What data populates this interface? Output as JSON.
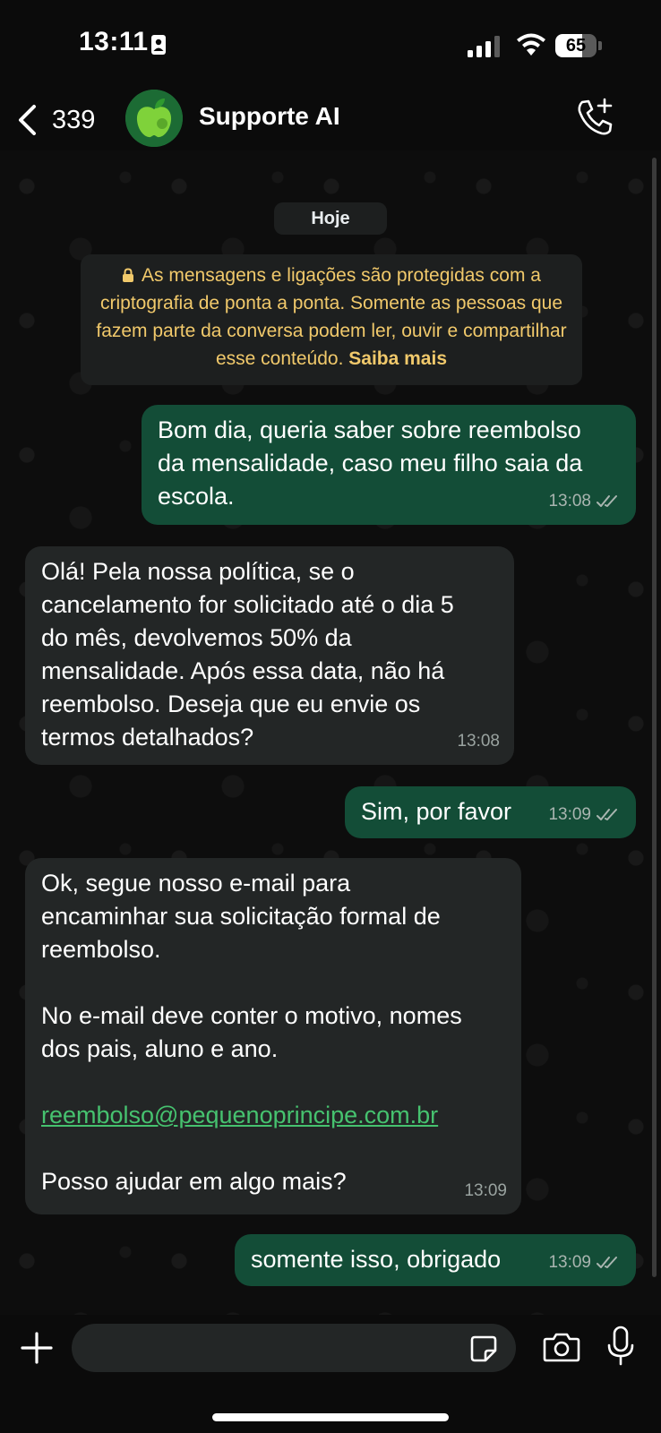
{
  "status": {
    "time": "13:11",
    "battery": "65",
    "battery_level": 0.65
  },
  "header": {
    "back_count": "339",
    "contact_name": "Supporte AI"
  },
  "chat": {
    "date": "Hoje",
    "encryption_text": "As mensagens e ligações são protegidas com a criptografia de ponta a ponta. Somente as pessoas que fazem parte da conversa podem ler, ouvir e compartilhar esse conteúdo.",
    "encryption_link": "Saiba mais",
    "messages": [
      {
        "direction": "out",
        "lines": [
          "Bom dia, queria saber sobre reembolso",
          "da mensalidade, caso meu filho saia da",
          "escola."
        ],
        "time": "13:08"
      },
      {
        "direction": "in",
        "lines": [
          "Olá! Pela nossa política, se o",
          "cancelamento for solicitado até o dia 5",
          "do mês, devolvemos 50% da",
          "mensalidade. Após essa data, não há",
          "reembolso. Deseja que eu envie os",
          "termos detalhados?"
        ],
        "time": "13:08"
      },
      {
        "direction": "out",
        "lines": [
          "Sim, por favor"
        ],
        "time": "13:09"
      },
      {
        "direction": "in",
        "lines": [
          "Ok, segue nosso e-mail para",
          "encaminhar sua solicitação formal de",
          "reembolso.",
          "",
          "No e-mail deve conter o motivo, nomes",
          "dos pais, aluno e ano.",
          "",
          "reembolso@pequenoprincipe.com.br",
          "",
          "Posso ajudar em algo mais?"
        ],
        "link": "reembolso@pequenoprincipe.com.br",
        "time": "13:09"
      },
      {
        "direction": "out",
        "lines": [
          "somente isso, obrigado"
        ],
        "time": "13:09"
      }
    ]
  },
  "colors": {
    "outgoing_bubble": "#134d37",
    "incoming_bubble": "#232626",
    "encryption_text": "#f1c96b",
    "link": "#46c26f"
  },
  "icons": [
    "id-badge-icon",
    "signal-icon",
    "wifi-icon",
    "battery-icon",
    "back-chevron-icon",
    "add-call-icon",
    "lock-icon",
    "double-check-icon",
    "plus-icon",
    "sticker-icon",
    "camera-icon",
    "microphone-icon"
  ]
}
